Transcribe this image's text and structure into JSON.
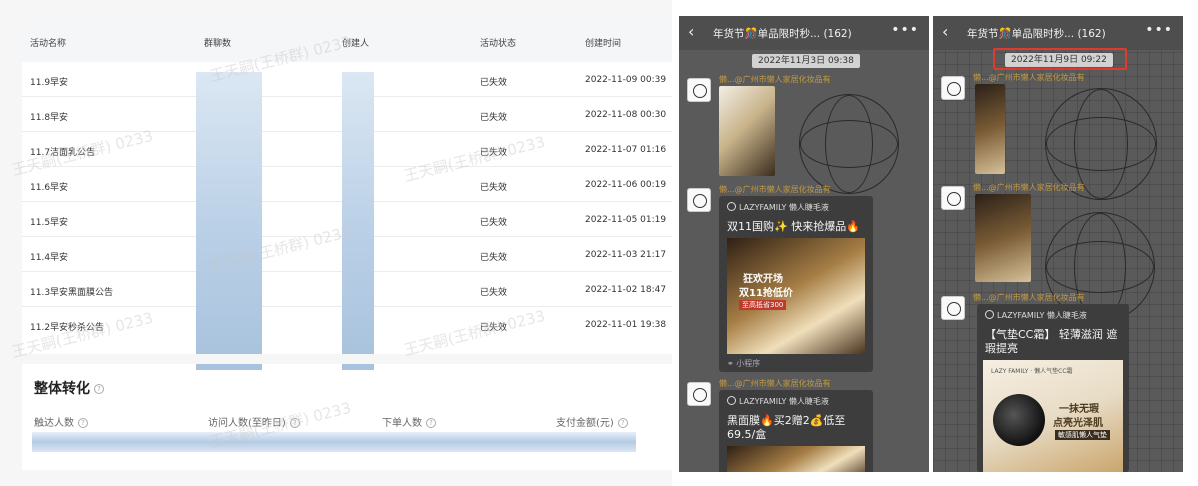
{
  "table": {
    "headers": [
      "活动名称",
      "群聊数",
      "创建人",
      "活动状态",
      "创建时间"
    ],
    "rows": [
      {
        "name": "11.9早安",
        "status": "已失效",
        "time": "2022-11-09 00:39"
      },
      {
        "name": "11.8早安",
        "status": "已失效",
        "time": "2022-11-08 00:30"
      },
      {
        "name": "11.7洁面乳公告",
        "status": "已失效",
        "time": "2022-11-07 01:16"
      },
      {
        "name": "11.6早安",
        "status": "已失效",
        "time": "2022-11-06 00:19"
      },
      {
        "name": "11.5早安",
        "status": "已失效",
        "time": "2022-11-05 01:19"
      },
      {
        "name": "11.4早安",
        "status": "已失效",
        "time": "2022-11-03 21:17"
      },
      {
        "name": "11.3早安黑面膜公告",
        "status": "已失效",
        "time": "2022-11-02 18:47"
      },
      {
        "name": "11.2早安秒杀公告",
        "status": "已失效",
        "time": "2022-11-01 19:38"
      }
    ]
  },
  "summary": {
    "title": "整体转化",
    "metrics": [
      "触达人数",
      "访问人数(至昨日)",
      "下单人数",
      "支付金额(元)"
    ],
    "help_glyph": "?"
  },
  "watermark": "王天嗣(王桥群) 0233",
  "chat1": {
    "title": "年货节🎊单品限时秒...",
    "count": "(162)",
    "timestamp": "2022年11月3日 09:38",
    "sender": "懒...@广州市懒人家居化妆品有",
    "card1_brand": "LAZYFAMILY 懒人睫毛液",
    "card1_text": "双11国购✨ 快来抢爆品🔥",
    "card1_promo_1": "狂欢开场",
    "card1_promo_2": "双11抢低价",
    "card1_promo_tag": "至高抵省300",
    "card1_footer": "小程序",
    "card2_brand": "LAZYFAMILY 懒人睫毛液",
    "card2_text": "黑面膜🔥买2赠2💰低至69.5/盒"
  },
  "chat2": {
    "title": "年货节🎊单品限时秒...",
    "count": "(162)",
    "timestamp": "2022年11月9日 09:22",
    "sender": "懒...@广州市懒人家居化妆品有",
    "card_brand": "LAZYFAMILY 懒人睫毛液",
    "card_text": "【气垫CC霜】 轻薄滋润 遮瑕提亮",
    "promo_brand": "LAZY FAMILY · 懒人气垫CC霜",
    "promo_line1": "一抹无瑕",
    "promo_line2": "点亮光泽肌",
    "promo_tag": "敏感肌懒人气垫"
  },
  "icons": {
    "back": "back-chevron-icon",
    "more": "more-dots-icon",
    "mini_program": "link-icon"
  },
  "colors": {
    "highlight": "#e03a2f",
    "chat_bg": "#5a5a5a",
    "sender_name": "#c49a42"
  }
}
